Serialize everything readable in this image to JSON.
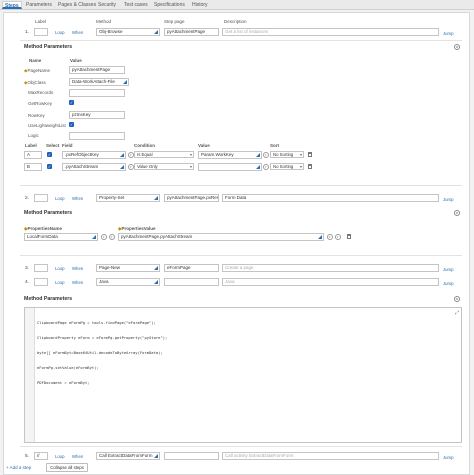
{
  "tabs": [
    "Steps",
    "Parameters",
    "Pages & Classes",
    "Security",
    "Test cases",
    "Specifications",
    "History"
  ],
  "columns": {
    "label": "Label",
    "method": "Method",
    "step_page": "Step page",
    "description": "Description"
  },
  "loop": "Loop",
  "when": "When",
  "jump": "Jump",
  "step1": {
    "number": "1.",
    "method": "Obj-Browse",
    "step_page": "pyAttachmentPage",
    "description": "Get a list of instances"
  },
  "method_params_title": "Method Parameters",
  "params1": {
    "name_header": "Name",
    "value_header": "Value",
    "rows": [
      {
        "name": "PageName",
        "value": "pyAttachmentPage"
      },
      {
        "name": "ObjClass",
        "value": "Data-WorkAttach-File"
      },
      {
        "name": "MaxRecords",
        "value": ""
      },
      {
        "name": "GetRowKey",
        "value": ""
      },
      {
        "name": "RowKey",
        "value": "pzInsKey"
      },
      {
        "name": "UseLightweightList",
        "value": ""
      },
      {
        "name": "Logic",
        "value": ""
      }
    ],
    "filter_headers": {
      "label": "Label",
      "select": "Select",
      "field": "Field",
      "condition": "Condition",
      "value": "Value",
      "sort": "Sort"
    },
    "filters": [
      {
        "label": "A",
        "field": ".pxRefObjectKey",
        "condition": "Is Equal",
        "value": "Param.WorkKey",
        "sort": "No Sorting"
      },
      {
        "label": "B",
        "field": ".pyAttachStream",
        "condition": "Value Only",
        "value": "",
        "sort": "No Sorting"
      }
    ]
  },
  "step2": {
    "number": "2.",
    "method": "Property-Set",
    "step_page": "pyAttachmentPage.pxRes",
    "description": "Form Data"
  },
  "params2": {
    "prop_header": "PropertiesName",
    "val_header": "PropertiesValue",
    "rows": [
      {
        "name": "LocalFormData",
        "value": "pyAttachmentPage.pyAttachStream"
      }
    ]
  },
  "step3": {
    "number": "3.",
    "method": "Page-New",
    "step_page": "eFormPage",
    "description": "Create a page"
  },
  "step4": {
    "number": "4.",
    "method": "Java",
    "step_page": "",
    "description": "Java"
  },
  "code_lines": [
    "ClipboardPage eFormPg = tools.findPage(\"eFormPage\");",
    "ClipboardProperty eForm = eFormPg.getProperty(\"pyStore\");",
    "byte[] eFormByt=Base64Util.decodeToByteArray(FormData);",
    "eFormPg.setValue(eFormByt);",
    "PDFDocument = eFormByt;"
  ],
  "step5": {
    "number": "5.",
    "label": "//",
    "method": "Call ExtractDataFromForm",
    "step_page": "",
    "description": "Call activity ExtractDataFromForm"
  },
  "add_step": "Add a step",
  "collapse_all": "Collapse all steps"
}
